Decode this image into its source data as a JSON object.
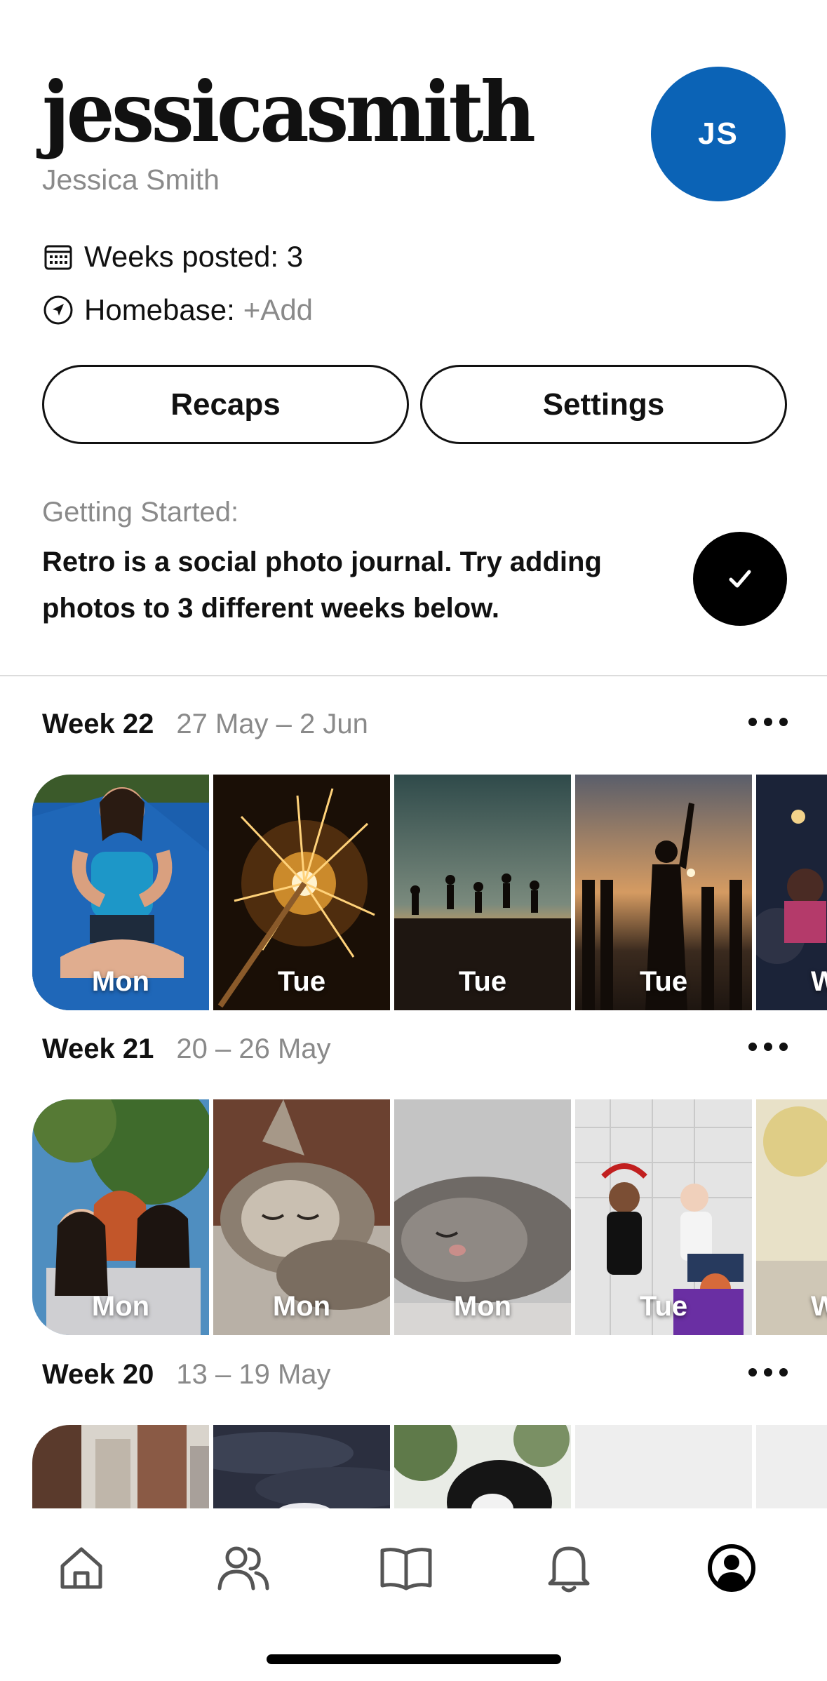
{
  "profile": {
    "username": "jessicasmith",
    "full_name": "Jessica Smith",
    "initials": "JS",
    "avatar_color": "#0b63b6"
  },
  "stats": {
    "weeks_posted_label": "Weeks posted: 3",
    "homebase_label": "Homebase:",
    "homebase_action": "+Add"
  },
  "buttons": {
    "recaps": "Recaps",
    "settings": "Settings"
  },
  "getting_started": {
    "label": "Getting Started:",
    "text": "Retro is a social photo journal. Try adding photos to 3 different weeks below."
  },
  "weeks": [
    {
      "title": "Week 22",
      "range": "27 May – 2 Jun",
      "tiles": [
        {
          "day": "Mon",
          "photo": "woman-meditating-on-yoga-mat"
        },
        {
          "day": "Tue",
          "photo": "sparkler"
        },
        {
          "day": "Tue",
          "photo": "people-jumping-at-sunset"
        },
        {
          "day": "Tue",
          "photo": "silhouette-at-sunset-beach"
        },
        {
          "day": "W",
          "photo": "crowd-at-concert"
        }
      ]
    },
    {
      "title": "Week 21",
      "range": "20 – 26 May",
      "tiles": [
        {
          "day": "Mon",
          "photo": "three-friends-hugging"
        },
        {
          "day": "Mon",
          "photo": "sleeping-kitten"
        },
        {
          "day": "Mon",
          "photo": "sleeping-cat-closeup"
        },
        {
          "day": "Tue",
          "photo": "friends-sitting-on-floor"
        },
        {
          "day": "W",
          "photo": "blurred-yellow"
        }
      ]
    },
    {
      "title": "Week 20",
      "range": "13 – 19 May",
      "tiles": [
        {
          "day": "",
          "photo": "city-buildings"
        },
        {
          "day": "",
          "photo": "cloudy-sky"
        },
        {
          "day": "",
          "photo": "dog-and-trees"
        },
        {
          "day": "",
          "photo": "empty"
        },
        {
          "day": "",
          "photo": "empty"
        }
      ]
    }
  ],
  "tabbar": {
    "items": [
      "home-icon",
      "friends-icon",
      "journal-icon",
      "notifications-icon",
      "profile-icon"
    ],
    "active": "profile-icon"
  }
}
